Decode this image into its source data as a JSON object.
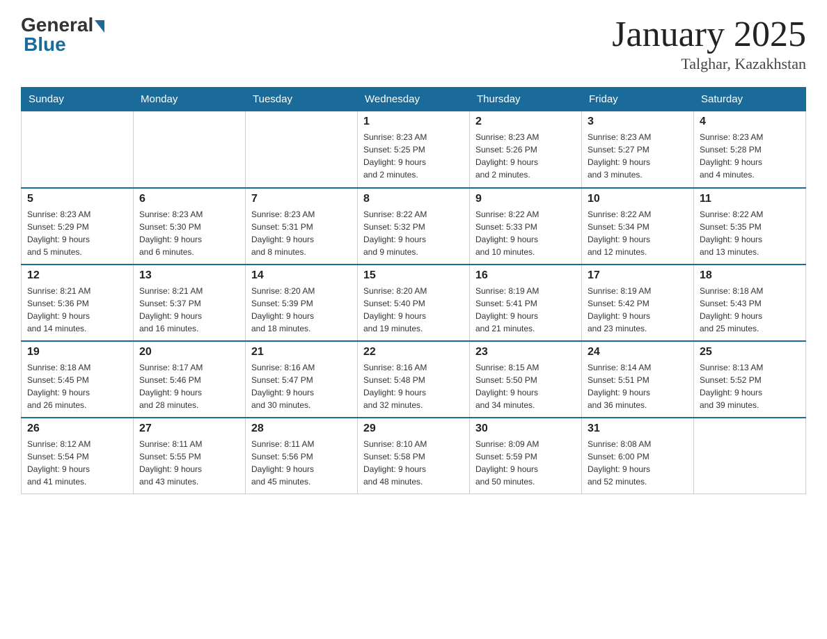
{
  "header": {
    "logo_general": "General",
    "logo_blue": "Blue",
    "month_title": "January 2025",
    "location": "Talghar, Kazakhstan"
  },
  "weekdays": [
    "Sunday",
    "Monday",
    "Tuesday",
    "Wednesday",
    "Thursday",
    "Friday",
    "Saturday"
  ],
  "weeks": [
    [
      {
        "day": "",
        "info": ""
      },
      {
        "day": "",
        "info": ""
      },
      {
        "day": "",
        "info": ""
      },
      {
        "day": "1",
        "info": "Sunrise: 8:23 AM\nSunset: 5:25 PM\nDaylight: 9 hours\nand 2 minutes."
      },
      {
        "day": "2",
        "info": "Sunrise: 8:23 AM\nSunset: 5:26 PM\nDaylight: 9 hours\nand 2 minutes."
      },
      {
        "day": "3",
        "info": "Sunrise: 8:23 AM\nSunset: 5:27 PM\nDaylight: 9 hours\nand 3 minutes."
      },
      {
        "day": "4",
        "info": "Sunrise: 8:23 AM\nSunset: 5:28 PM\nDaylight: 9 hours\nand 4 minutes."
      }
    ],
    [
      {
        "day": "5",
        "info": "Sunrise: 8:23 AM\nSunset: 5:29 PM\nDaylight: 9 hours\nand 5 minutes."
      },
      {
        "day": "6",
        "info": "Sunrise: 8:23 AM\nSunset: 5:30 PM\nDaylight: 9 hours\nand 6 minutes."
      },
      {
        "day": "7",
        "info": "Sunrise: 8:23 AM\nSunset: 5:31 PM\nDaylight: 9 hours\nand 8 minutes."
      },
      {
        "day": "8",
        "info": "Sunrise: 8:22 AM\nSunset: 5:32 PM\nDaylight: 9 hours\nand 9 minutes."
      },
      {
        "day": "9",
        "info": "Sunrise: 8:22 AM\nSunset: 5:33 PM\nDaylight: 9 hours\nand 10 minutes."
      },
      {
        "day": "10",
        "info": "Sunrise: 8:22 AM\nSunset: 5:34 PM\nDaylight: 9 hours\nand 12 minutes."
      },
      {
        "day": "11",
        "info": "Sunrise: 8:22 AM\nSunset: 5:35 PM\nDaylight: 9 hours\nand 13 minutes."
      }
    ],
    [
      {
        "day": "12",
        "info": "Sunrise: 8:21 AM\nSunset: 5:36 PM\nDaylight: 9 hours\nand 14 minutes."
      },
      {
        "day": "13",
        "info": "Sunrise: 8:21 AM\nSunset: 5:37 PM\nDaylight: 9 hours\nand 16 minutes."
      },
      {
        "day": "14",
        "info": "Sunrise: 8:20 AM\nSunset: 5:39 PM\nDaylight: 9 hours\nand 18 minutes."
      },
      {
        "day": "15",
        "info": "Sunrise: 8:20 AM\nSunset: 5:40 PM\nDaylight: 9 hours\nand 19 minutes."
      },
      {
        "day": "16",
        "info": "Sunrise: 8:19 AM\nSunset: 5:41 PM\nDaylight: 9 hours\nand 21 minutes."
      },
      {
        "day": "17",
        "info": "Sunrise: 8:19 AM\nSunset: 5:42 PM\nDaylight: 9 hours\nand 23 minutes."
      },
      {
        "day": "18",
        "info": "Sunrise: 8:18 AM\nSunset: 5:43 PM\nDaylight: 9 hours\nand 25 minutes."
      }
    ],
    [
      {
        "day": "19",
        "info": "Sunrise: 8:18 AM\nSunset: 5:45 PM\nDaylight: 9 hours\nand 26 minutes."
      },
      {
        "day": "20",
        "info": "Sunrise: 8:17 AM\nSunset: 5:46 PM\nDaylight: 9 hours\nand 28 minutes."
      },
      {
        "day": "21",
        "info": "Sunrise: 8:16 AM\nSunset: 5:47 PM\nDaylight: 9 hours\nand 30 minutes."
      },
      {
        "day": "22",
        "info": "Sunrise: 8:16 AM\nSunset: 5:48 PM\nDaylight: 9 hours\nand 32 minutes."
      },
      {
        "day": "23",
        "info": "Sunrise: 8:15 AM\nSunset: 5:50 PM\nDaylight: 9 hours\nand 34 minutes."
      },
      {
        "day": "24",
        "info": "Sunrise: 8:14 AM\nSunset: 5:51 PM\nDaylight: 9 hours\nand 36 minutes."
      },
      {
        "day": "25",
        "info": "Sunrise: 8:13 AM\nSunset: 5:52 PM\nDaylight: 9 hours\nand 39 minutes."
      }
    ],
    [
      {
        "day": "26",
        "info": "Sunrise: 8:12 AM\nSunset: 5:54 PM\nDaylight: 9 hours\nand 41 minutes."
      },
      {
        "day": "27",
        "info": "Sunrise: 8:11 AM\nSunset: 5:55 PM\nDaylight: 9 hours\nand 43 minutes."
      },
      {
        "day": "28",
        "info": "Sunrise: 8:11 AM\nSunset: 5:56 PM\nDaylight: 9 hours\nand 45 minutes."
      },
      {
        "day": "29",
        "info": "Sunrise: 8:10 AM\nSunset: 5:58 PM\nDaylight: 9 hours\nand 48 minutes."
      },
      {
        "day": "30",
        "info": "Sunrise: 8:09 AM\nSunset: 5:59 PM\nDaylight: 9 hours\nand 50 minutes."
      },
      {
        "day": "31",
        "info": "Sunrise: 8:08 AM\nSunset: 6:00 PM\nDaylight: 9 hours\nand 52 minutes."
      },
      {
        "day": "",
        "info": ""
      }
    ]
  ]
}
